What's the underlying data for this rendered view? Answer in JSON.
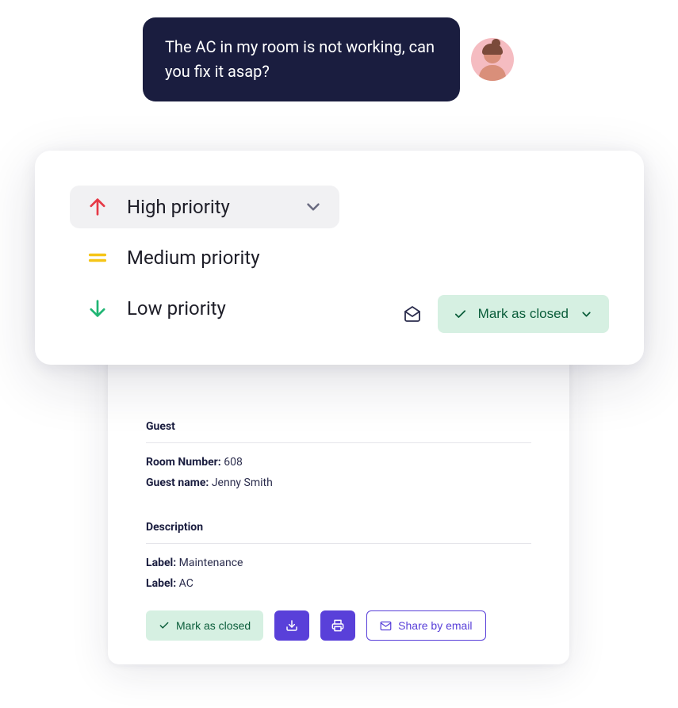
{
  "chat": {
    "message": "The AC in my room is not working, can you fix it asap?"
  },
  "priority": {
    "options": [
      {
        "label": "High priority",
        "icon": "arrow-up",
        "selected": true
      },
      {
        "label": "Medium priority",
        "icon": "equals",
        "selected": false
      },
      {
        "label": "Low priority",
        "icon": "arrow-down",
        "selected": false
      }
    ]
  },
  "mark_closed_label": "Mark as closed",
  "details": {
    "guest_heading": "Guest",
    "room_number_label": "Room Number:",
    "room_number_value": "608",
    "guest_name_label": "Guest name:",
    "guest_name_value": "Jenny Smith",
    "description_heading": "Description",
    "label1_key": "Label:",
    "label1_value": "Maintenance",
    "label2_key": "Label:",
    "label2_value": "AC"
  },
  "actions": {
    "mark_closed": "Mark as closed",
    "share_email": "Share by email"
  }
}
